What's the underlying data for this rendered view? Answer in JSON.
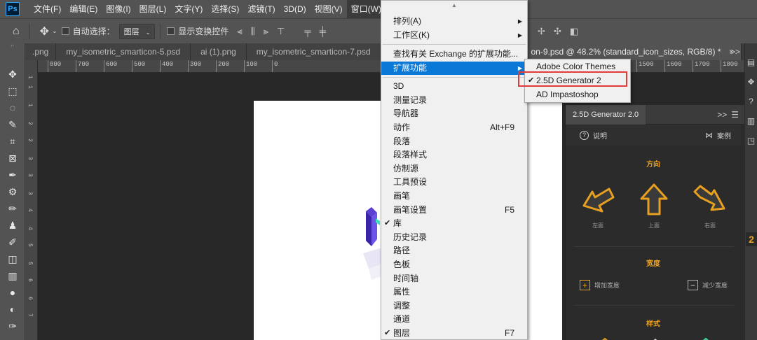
{
  "app": {
    "logo": "Ps"
  },
  "menubar": {
    "items": [
      "文件(F)",
      "编辑(E)",
      "图像(I)",
      "图层(L)",
      "文字(Y)",
      "选择(S)",
      "滤镜(T)",
      "3D(D)",
      "视图(V)",
      "窗口(W)"
    ],
    "active": "窗口(W)"
  },
  "options": {
    "auto_select_label": "自动选择：",
    "auto_select_value": "图层",
    "show_transform_label": "显示变换控件"
  },
  "tabs": [
    {
      "label": ".png"
    },
    {
      "label": "my_isometric_smarticon-5.psd"
    },
    {
      "label": "ai (1).png"
    },
    {
      "label": "my_isometric_smarticon-7.psd"
    },
    {
      "label": "on-9.psd @ 48.2% (standard_icon_sizes, RGB/8) *",
      "close": "×"
    }
  ],
  "tab_overflow": ">>",
  "ruler": {
    "h_labels": [
      "800",
      "700",
      "600",
      "500",
      "400",
      "300",
      "200",
      "100",
      "0",
      "1500",
      "1600",
      "1700",
      "1800"
    ],
    "v_labels": [
      "1",
      "1",
      "1",
      "2",
      "2",
      "3",
      "3",
      "3",
      "4",
      "4",
      "5",
      "5",
      "6",
      "6",
      "7"
    ]
  },
  "window_menu": {
    "scroll_up": "▲",
    "groups": [
      [
        {
          "label": "排列(A)",
          "arrow": "▶"
        },
        {
          "label": "工作区(K)",
          "arrow": "▶"
        }
      ],
      [
        {
          "label": "查找有关 Exchange 的扩展功能..."
        },
        {
          "label": "扩展功能",
          "arrow": "▶",
          "highlighted": true
        }
      ],
      [
        {
          "label": "3D"
        },
        {
          "label": "测量记录"
        },
        {
          "label": "导航器"
        },
        {
          "label": "动作",
          "shortcut": "Alt+F9"
        },
        {
          "label": "段落"
        },
        {
          "label": "段落样式"
        },
        {
          "label": "仿制源"
        },
        {
          "label": "工具预设"
        },
        {
          "label": "画笔"
        },
        {
          "label": "画笔设置",
          "shortcut": "F5"
        },
        {
          "label": "库",
          "checked": true
        },
        {
          "label": "历史记录"
        },
        {
          "label": "路径"
        },
        {
          "label": "色板"
        },
        {
          "label": "时间轴"
        },
        {
          "label": "属性"
        },
        {
          "label": "调整"
        },
        {
          "label": "通道"
        },
        {
          "label": "图层",
          "shortcut": "F7",
          "checked": true
        }
      ]
    ]
  },
  "ext_submenu": {
    "items": [
      {
        "label": "Adobe Color Themes"
      },
      {
        "label": "2.5D Generator 2",
        "checked": true
      },
      {
        "label": "AD Impastoshop"
      }
    ]
  },
  "plugin": {
    "tab": "2.5D Generator 2.0",
    "collapse": ">>",
    "menu": "☰",
    "help": "说明",
    "examples": "案例",
    "direction_title": "方向",
    "directions": [
      {
        "label": "左面"
      },
      {
        "label": "上面"
      },
      {
        "label": "右面"
      }
    ],
    "width_title": "宽度",
    "add_width": "增加宽度",
    "reduce_width": "减少宽度",
    "style_title": "样式"
  },
  "right_strip": {
    "number": "2"
  },
  "colors": {
    "accent": "#e8a020",
    "highlight": "#0a78d7",
    "annotation": "#e23b3b"
  }
}
